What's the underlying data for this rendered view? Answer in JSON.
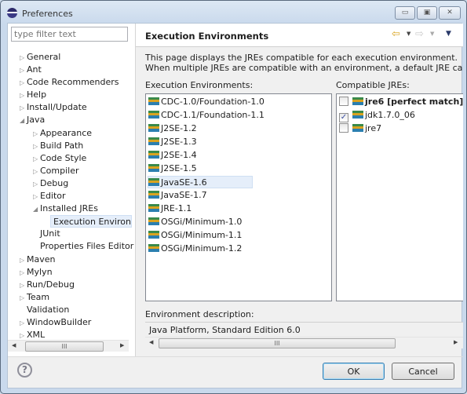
{
  "window": {
    "title": "Preferences",
    "minimize": "▭",
    "maximize": "▣",
    "close": "✕"
  },
  "filter": {
    "placeholder": "type filter text"
  },
  "tree": [
    {
      "label": "General",
      "level": 0,
      "arrow": "collapsed"
    },
    {
      "label": "Ant",
      "level": 0,
      "arrow": "collapsed"
    },
    {
      "label": "Code Recommenders",
      "level": 0,
      "arrow": "collapsed"
    },
    {
      "label": "Help",
      "level": 0,
      "arrow": "collapsed"
    },
    {
      "label": "Install/Update",
      "level": 0,
      "arrow": "collapsed"
    },
    {
      "label": "Java",
      "level": 0,
      "arrow": "expanded"
    },
    {
      "label": "Appearance",
      "level": 1,
      "arrow": "collapsed"
    },
    {
      "label": "Build Path",
      "level": 1,
      "arrow": "collapsed"
    },
    {
      "label": "Code Style",
      "level": 1,
      "arrow": "collapsed"
    },
    {
      "label": "Compiler",
      "level": 1,
      "arrow": "collapsed"
    },
    {
      "label": "Debug",
      "level": 1,
      "arrow": "collapsed"
    },
    {
      "label": "Editor",
      "level": 1,
      "arrow": "collapsed"
    },
    {
      "label": "Installed JREs",
      "level": 1,
      "arrow": "expanded"
    },
    {
      "label": "Execution Environm",
      "level": 2,
      "arrow": "none",
      "selected": true
    },
    {
      "label": "JUnit",
      "level": 1,
      "arrow": "none"
    },
    {
      "label": "Properties Files Editor",
      "level": 1,
      "arrow": "none"
    },
    {
      "label": "Maven",
      "level": 0,
      "arrow": "collapsed"
    },
    {
      "label": "Mylyn",
      "level": 0,
      "arrow": "collapsed"
    },
    {
      "label": "Run/Debug",
      "level": 0,
      "arrow": "collapsed"
    },
    {
      "label": "Team",
      "level": 0,
      "arrow": "collapsed"
    },
    {
      "label": "Validation",
      "level": 0,
      "arrow": "none"
    },
    {
      "label": "WindowBuilder",
      "level": 0,
      "arrow": "collapsed"
    },
    {
      "label": "XML",
      "level": 0,
      "arrow": "collapsed"
    }
  ],
  "page": {
    "title": "Execution Environments",
    "desc1": "This page displays the JREs compatible for each execution environment.",
    "desc2": "When multiple JREs are compatible with an environment, a default JRE can be specifi",
    "env_label": "Execution Environments:",
    "jre_label": "Compatible JREs:",
    "environments": [
      "CDC-1.0/Foundation-1.0",
      "CDC-1.1/Foundation-1.1",
      "J2SE-1.2",
      "J2SE-1.3",
      "J2SE-1.4",
      "J2SE-1.5",
      "JavaSE-1.6",
      "JavaSE-1.7",
      "JRE-1.1",
      "OSGi/Minimum-1.0",
      "OSGi/Minimum-1.1",
      "OSGi/Minimum-1.2"
    ],
    "selected_environment": "JavaSE-1.6",
    "jres": [
      {
        "label": "jre6 [perfect match]",
        "checked": false,
        "bold": true
      },
      {
        "label": "jdk1.7.0_06",
        "checked": true,
        "bold": false
      },
      {
        "label": "jre7",
        "checked": false,
        "bold": false
      }
    ],
    "envdesc_label": "Environment description:",
    "envdesc_value": "Java Platform, Standard Edition 6.0"
  },
  "scroll_grip": "III",
  "buttons": {
    "ok": "OK",
    "cancel": "Cancel",
    "help": "?"
  },
  "colors": {
    "accent": "#3c7fb1",
    "selection": "#e5eefa"
  }
}
